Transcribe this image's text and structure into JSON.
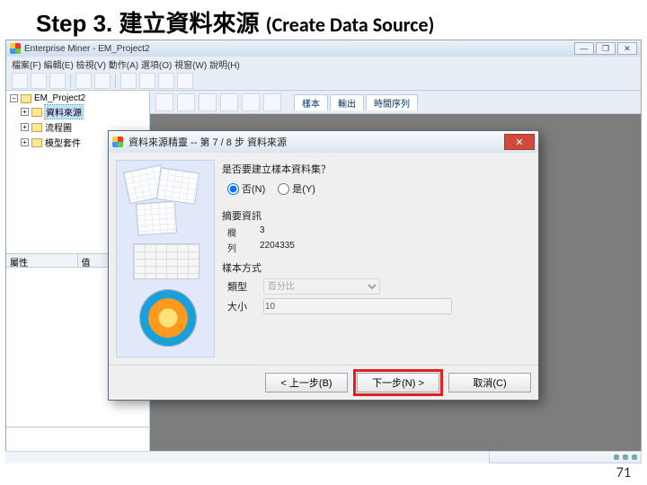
{
  "slide": {
    "step": "Step 3.",
    "title_zh": "建立資料來源",
    "title_en": "(Create Data Source)",
    "page_number": "71"
  },
  "app": {
    "title": "Enterprise Miner - EM_Project2",
    "menu": "檔案(F)  編輯(E)  檢視(V)  動作(A)  選項(O)  視窗(W)  說明(H)",
    "tree": {
      "root": "EM_Project2",
      "n_datasrc": "資料來源",
      "n_diagram": "流程圖",
      "n_model": "模型套件"
    },
    "prop": {
      "col1": "屬性",
      "col2": "值"
    },
    "tabs": {
      "t1": "樣本",
      "t2": "輸出",
      "t3": "時間序列"
    }
  },
  "dialog": {
    "title": "資料來源精靈 -- 第 7 / 8 步 資料來源",
    "question": "是否要建立樣本資料集？",
    "opt_no": "否(N)",
    "opt_yes": "是(Y)",
    "sec_summary": "摘要資訊",
    "rows_k": "欄",
    "rows_v": "3",
    "cols_k": "列",
    "cols_v": "2204335",
    "sec_sample": "樣本方式",
    "type_k": "類型",
    "type_v": "百分比",
    "size_k": "大小",
    "size_v": "10",
    "btn_back": "< 上一步(B)",
    "btn_next": "下一步(N) >",
    "btn_cancel": "取消(C)"
  }
}
